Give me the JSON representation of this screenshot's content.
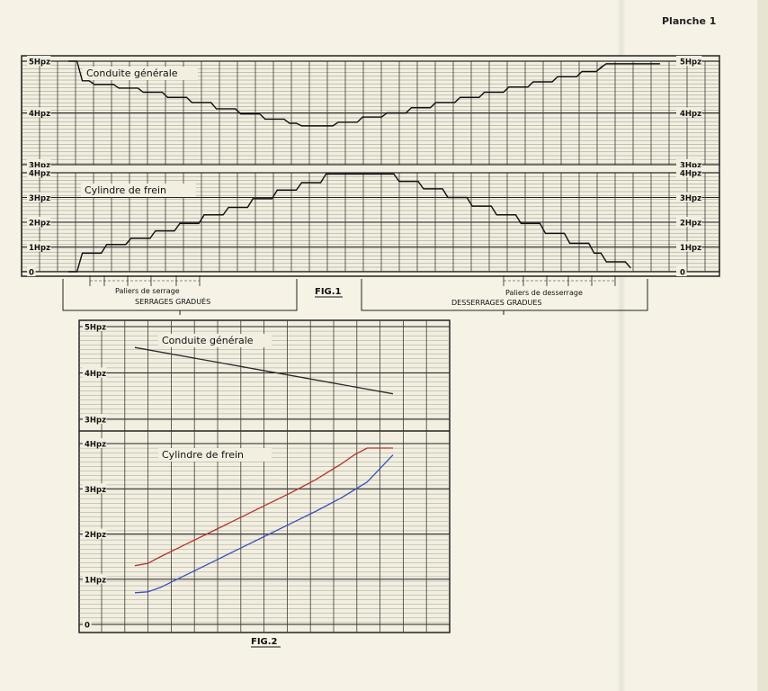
{
  "page": {
    "planche": "Planche 1"
  },
  "chart_data": [
    {
      "type": "line",
      "figure": "FIG.1",
      "panels": [
        {
          "title": "Conduite générale",
          "ylim": [
            3,
            5
          ],
          "yticks": [
            "3Hpz",
            "4Hpz",
            "5Hpz"
          ],
          "series": [
            {
              "x": [
                0,
                0.5,
                1,
                2,
                3,
                4,
                5,
                6,
                7,
                8,
                9,
                9.5,
                10,
                11,
                12,
                13,
                14,
                15,
                16,
                17,
                18,
                19,
                20,
                21,
                21.8,
                22,
                23,
                24,
                24.2
              ],
              "y": [
                5.0,
                4.62,
                4.55,
                4.48,
                4.4,
                4.3,
                4.2,
                4.08,
                3.98,
                3.88,
                3.8,
                3.75,
                3.75,
                3.82,
                3.92,
                4.0,
                4.1,
                4.2,
                4.3,
                4.4,
                4.5,
                4.6,
                4.7,
                4.8,
                4.88,
                4.95,
                4.95,
                4.95,
                4.95
              ]
            }
          ]
        },
        {
          "title": "Cylindre de frein",
          "ylim": [
            0,
            4
          ],
          "yticks": [
            "0",
            "1Hpz",
            "2Hpz",
            "3Hpz",
            "4Hpz"
          ],
          "series": [
            {
              "x": [
                0,
                0.5,
                1.5,
                2.5,
                3.5,
                4.5,
                5.5,
                6.5,
                7.5,
                8.5,
                9.5,
                10.5,
                11.5,
                12.5,
                13.5,
                14.5,
                15.5,
                16.5,
                17.5,
                18.5,
                19.5,
                20.5,
                21.5,
                22,
                23
              ],
              "y": [
                0,
                0.75,
                1.1,
                1.35,
                1.65,
                1.95,
                2.3,
                2.6,
                2.95,
                3.3,
                3.6,
                3.95,
                3.95,
                3.95,
                3.65,
                3.35,
                3.0,
                2.65,
                2.3,
                1.95,
                1.55,
                1.15,
                0.75,
                0.4,
                0.15
              ]
            }
          ]
        }
      ],
      "annotations": {
        "left_small": "Paliers de serrage",
        "left_caption": "SERRAGES GRADUÉS",
        "right_small": "Paliers de desserrage",
        "right_caption": "DESSERRAGES GRADUES"
      }
    },
    {
      "type": "line",
      "figure": "FIG.2",
      "panels": [
        {
          "title": "Conduite générale",
          "ylim": [
            3,
            5
          ],
          "yticks": [
            "3Hpz",
            "4Hpz",
            "5Hpz"
          ],
          "series": [
            {
              "x": [
                0,
                10
              ],
              "y": [
                4.55,
                3.55
              ],
              "color": "#2a2a2a"
            }
          ]
        },
        {
          "title": "Cylindre de frein",
          "ylim": [
            0,
            4
          ],
          "yticks": [
            "0",
            "1Hpz",
            "2Hpz",
            "3Hpz",
            "4Hpz"
          ],
          "series": [
            {
              "x": [
                0,
                0.5,
                1,
                2,
                3,
                4,
                5,
                6,
                7,
                8,
                8.5,
                9,
                10
              ],
              "y": [
                1.3,
                1.35,
                1.5,
                1.78,
                2.06,
                2.34,
                2.62,
                2.9,
                3.2,
                3.55,
                3.75,
                3.9,
                3.9
              ],
              "color": "#b8322a"
            },
            {
              "x": [
                0,
                0.5,
                1,
                2,
                3,
                4,
                5,
                6,
                7,
                8,
                9,
                9.5,
                10
              ],
              "y": [
                0.7,
                0.72,
                0.82,
                1.1,
                1.38,
                1.66,
                1.94,
                2.22,
                2.5,
                2.8,
                3.15,
                3.45,
                3.75
              ],
              "color": "#3a4fc0"
            }
          ]
        }
      ]
    }
  ]
}
